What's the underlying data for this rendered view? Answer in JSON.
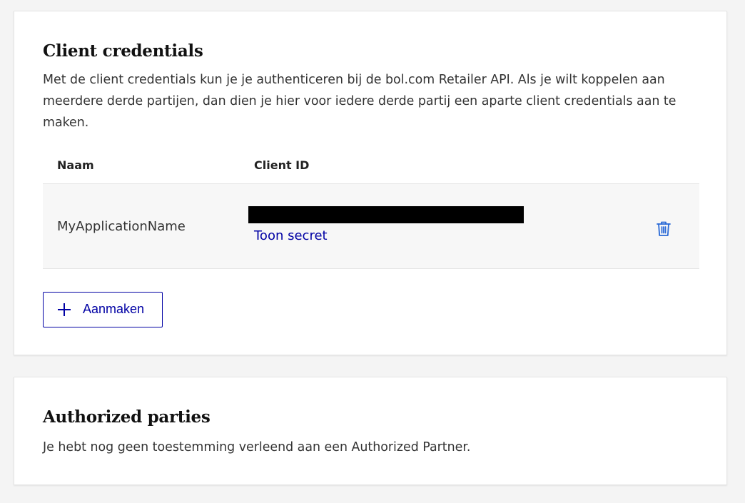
{
  "client_credentials": {
    "title": "Client credentials",
    "description": "Met de client credentials kun je je authenticeren bij de bol.com Retailer API. Als je wilt koppelen aan meerdere derde partijen, dan dien je hier voor iedere derde partij een aparte client credentials aan te maken.",
    "columns": {
      "name": "Naam",
      "client_id": "Client ID"
    },
    "rows": [
      {
        "name": "MyApplicationName",
        "client_id_redacted": true,
        "show_secret_label": "Toon secret",
        "delete_icon": "trash-icon"
      }
    ],
    "create_button": {
      "label": "Aanmaken",
      "icon": "plus-icon"
    }
  },
  "authorized_parties": {
    "title": "Authorized parties",
    "description": "Je hebt nog geen toestemming verleend aan een Authorized Partner."
  },
  "colors": {
    "link": "#0000a4",
    "delete_icon": "#2a6ad6",
    "background": "#f4f4f4",
    "card": "#ffffff"
  }
}
